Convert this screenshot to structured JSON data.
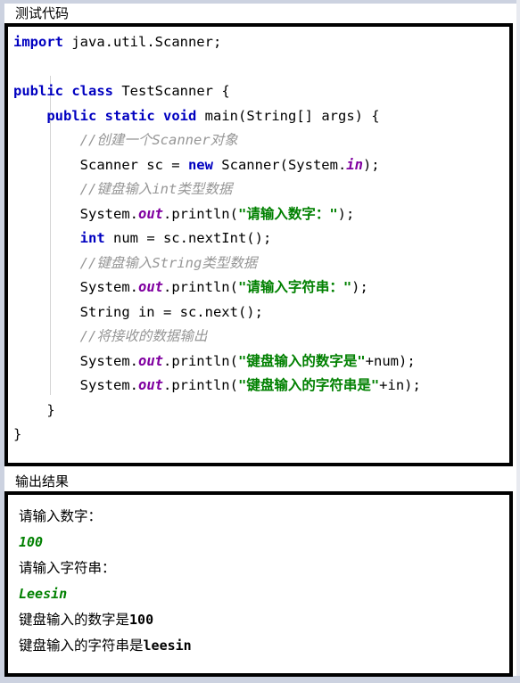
{
  "page": {
    "background_color": "#ffffff",
    "border_color": "#000000",
    "edge_tint_color": "#ccd2e0"
  },
  "code_section": {
    "title": "测试代码",
    "language": "java",
    "syntax_colors": {
      "keyword": "#0000c0",
      "string": "#008000",
      "comment": "#969696",
      "field": "#8000a0",
      "plain": "#000000"
    },
    "lines": [
      {
        "id": 1,
        "tokens": [
          {
            "t": "import",
            "c": "kw"
          },
          {
            "t": " java.util.Scanner;",
            "c": "plain"
          }
        ]
      },
      {
        "id": 2,
        "tokens": []
      },
      {
        "id": 3,
        "tokens": [
          {
            "t": "public",
            "c": "kw"
          },
          {
            "t": " ",
            "c": "plain"
          },
          {
            "t": "class",
            "c": "kw"
          },
          {
            "t": " TestScanner {",
            "c": "plain"
          }
        ]
      },
      {
        "id": 4,
        "tokens": [
          {
            "t": "    ",
            "c": "plain"
          },
          {
            "t": "public",
            "c": "kw"
          },
          {
            "t": " ",
            "c": "plain"
          },
          {
            "t": "static",
            "c": "kw"
          },
          {
            "t": " ",
            "c": "plain"
          },
          {
            "t": "void",
            "c": "kw"
          },
          {
            "t": " main(String[] args) {",
            "c": "plain"
          }
        ]
      },
      {
        "id": 5,
        "tokens": [
          {
            "t": "        ",
            "c": "plain"
          },
          {
            "t": "//创建一个Scanner对象",
            "c": "cmt"
          }
        ]
      },
      {
        "id": 6,
        "tokens": [
          {
            "t": "        Scanner sc = ",
            "c": "plain"
          },
          {
            "t": "new",
            "c": "kw"
          },
          {
            "t": " Scanner(System.",
            "c": "plain"
          },
          {
            "t": "in",
            "c": "fld"
          },
          {
            "t": ");",
            "c": "plain"
          }
        ]
      },
      {
        "id": 7,
        "tokens": [
          {
            "t": "        ",
            "c": "plain"
          },
          {
            "t": "//键盘输入int类型数据",
            "c": "cmt"
          }
        ]
      },
      {
        "id": 8,
        "tokens": [
          {
            "t": "        System.",
            "c": "plain"
          },
          {
            "t": "out",
            "c": "fld"
          },
          {
            "t": ".println(",
            "c": "plain"
          },
          {
            "t": "\"请输入数字：\"",
            "c": "str"
          },
          {
            "t": ");",
            "c": "plain"
          }
        ]
      },
      {
        "id": 9,
        "tokens": [
          {
            "t": "        ",
            "c": "plain"
          },
          {
            "t": "int",
            "c": "kw"
          },
          {
            "t": " num = sc.nextInt();",
            "c": "plain"
          }
        ]
      },
      {
        "id": 10,
        "tokens": [
          {
            "t": "        ",
            "c": "plain"
          },
          {
            "t": "//键盘输入String类型数据",
            "c": "cmt"
          }
        ]
      },
      {
        "id": 11,
        "tokens": [
          {
            "t": "        System.",
            "c": "plain"
          },
          {
            "t": "out",
            "c": "fld"
          },
          {
            "t": ".println(",
            "c": "plain"
          },
          {
            "t": "\"请输入字符串：\"",
            "c": "str"
          },
          {
            "t": ");",
            "c": "plain"
          }
        ]
      },
      {
        "id": 12,
        "tokens": [
          {
            "t": "        String in = sc.next();",
            "c": "plain"
          }
        ]
      },
      {
        "id": 13,
        "tokens": [
          {
            "t": "        ",
            "c": "plain"
          },
          {
            "t": "//将接收的数据输出",
            "c": "cmt"
          }
        ]
      },
      {
        "id": 14,
        "tokens": [
          {
            "t": "        System.",
            "c": "plain"
          },
          {
            "t": "out",
            "c": "fld"
          },
          {
            "t": ".println(",
            "c": "plain"
          },
          {
            "t": "\"键盘输入的数字是\"",
            "c": "str"
          },
          {
            "t": "+num);",
            "c": "plain"
          }
        ]
      },
      {
        "id": 15,
        "tokens": [
          {
            "t": "        System.",
            "c": "plain"
          },
          {
            "t": "out",
            "c": "fld"
          },
          {
            "t": ".println(",
            "c": "plain"
          },
          {
            "t": "\"键盘输入的字符串是\"",
            "c": "str"
          },
          {
            "t": "+in);",
            "c": "plain"
          }
        ]
      },
      {
        "id": 16,
        "tokens": [
          {
            "t": "    }",
            "c": "plain"
          }
        ]
      },
      {
        "id": 17,
        "tokens": [
          {
            "t": "}",
            "c": "plain"
          }
        ]
      }
    ]
  },
  "output_section": {
    "title": "输出结果",
    "user_input_color": "#008000",
    "lines": [
      {
        "id": 1,
        "kind": "program",
        "text": "请输入数字："
      },
      {
        "id": 2,
        "kind": "user-input",
        "text": "100"
      },
      {
        "id": 3,
        "kind": "program",
        "text": "请输入字符串："
      },
      {
        "id": 4,
        "kind": "user-input",
        "text": "Leesin"
      },
      {
        "id": 5,
        "kind": "program-mixed",
        "text": "键盘输入的数字是",
        "value": "100"
      },
      {
        "id": 6,
        "kind": "program-mixed",
        "text": "键盘输入的字符串是",
        "value": "leesin"
      }
    ]
  }
}
